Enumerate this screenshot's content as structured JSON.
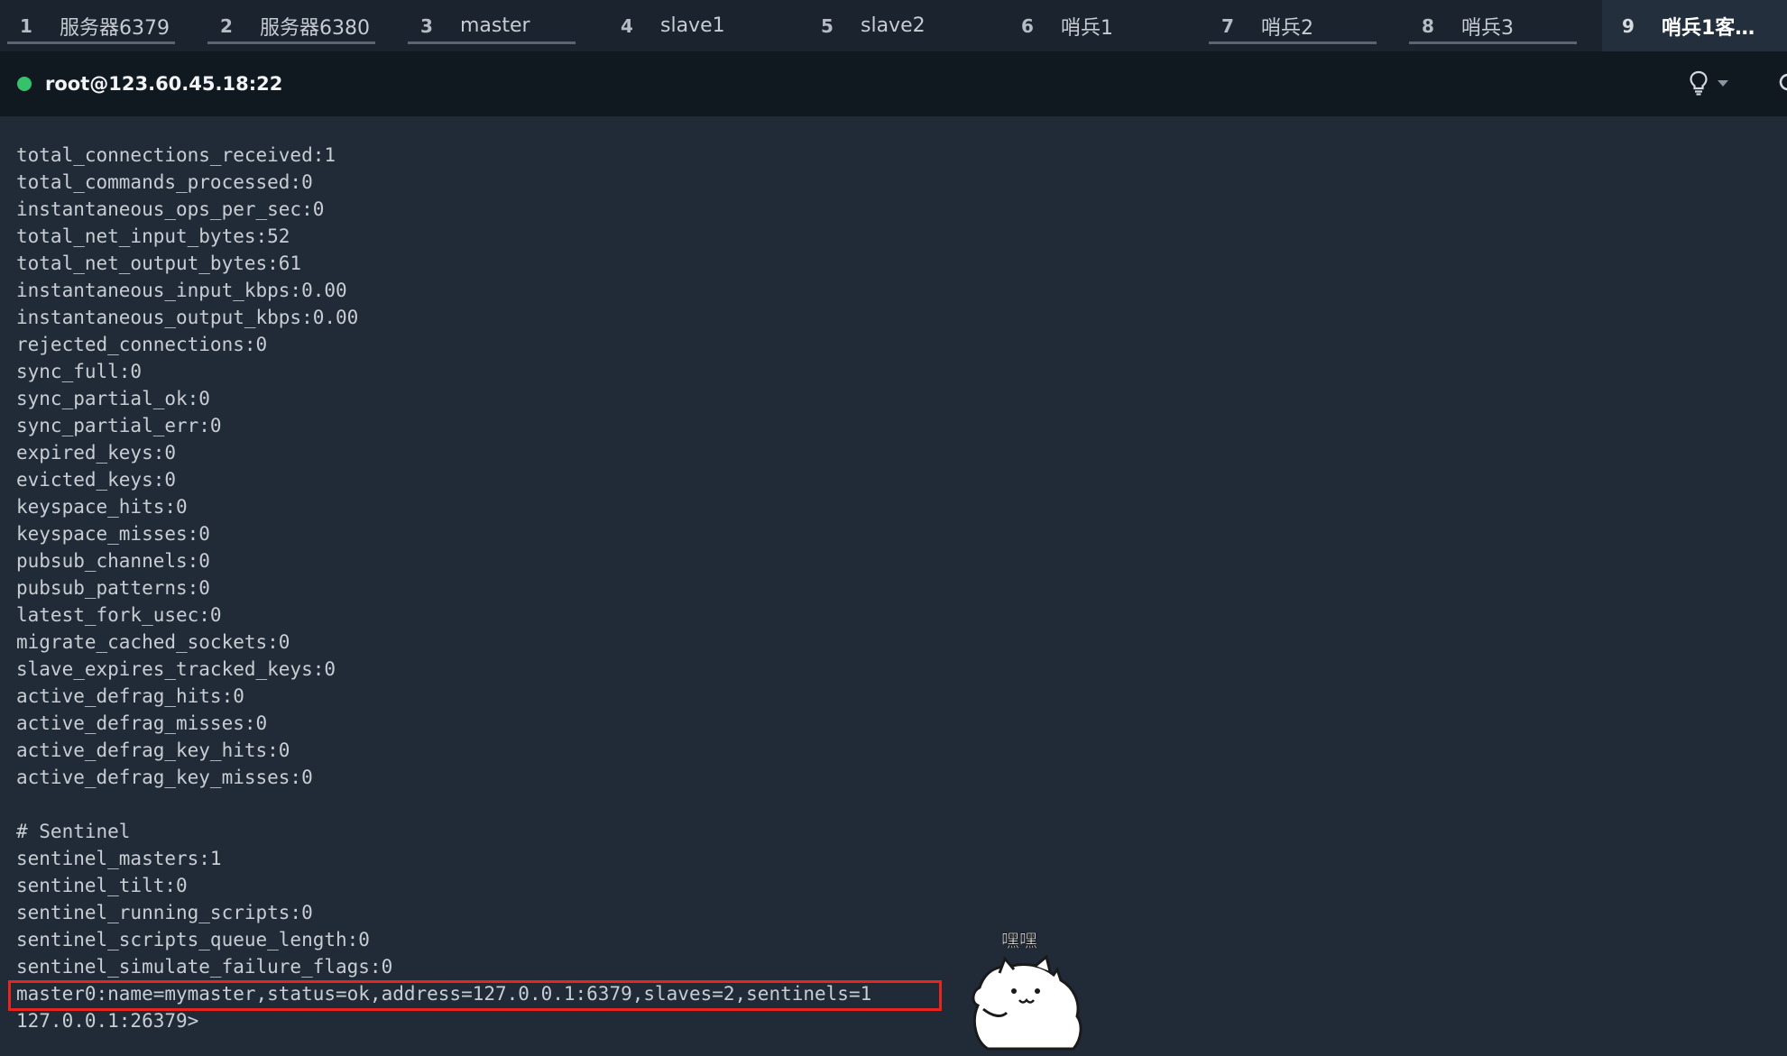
{
  "tabs": [
    {
      "num": "1",
      "label": "服务器6379"
    },
    {
      "num": "2",
      "label": "服务器6380"
    },
    {
      "num": "3",
      "label": "master"
    },
    {
      "num": "4",
      "label": "slave1"
    },
    {
      "num": "5",
      "label": "slave2"
    },
    {
      "num": "6",
      "label": "哨兵1"
    },
    {
      "num": "7",
      "label": "哨兵2"
    },
    {
      "num": "8",
      "label": "哨兵3"
    },
    {
      "num": "9",
      "label": "哨兵1客…",
      "active": true
    }
  ],
  "session": {
    "host": "root@123.60.45.18:22",
    "status": "connected",
    "status_color": "#35c26a",
    "hint_icon": "lightbulb-icon",
    "refresh_icon": "refresh-icon"
  },
  "terminal": {
    "lines": [
      "total_connections_received:1",
      "total_commands_processed:0",
      "instantaneous_ops_per_sec:0",
      "total_net_input_bytes:52",
      "total_net_output_bytes:61",
      "instantaneous_input_kbps:0.00",
      "instantaneous_output_kbps:0.00",
      "rejected_connections:0",
      "sync_full:0",
      "sync_partial_ok:0",
      "sync_partial_err:0",
      "expired_keys:0",
      "evicted_keys:0",
      "keyspace_hits:0",
      "keyspace_misses:0",
      "pubsub_channels:0",
      "pubsub_patterns:0",
      "latest_fork_usec:0",
      "migrate_cached_sockets:0",
      "slave_expires_tracked_keys:0",
      "active_defrag_hits:0",
      "active_defrag_misses:0",
      "active_defrag_key_hits:0",
      "active_defrag_key_misses:0",
      "",
      "# Sentinel",
      "sentinel_masters:1",
      "sentinel_tilt:0",
      "sentinel_running_scripts:0",
      "sentinel_scripts_queue_length:0",
      "sentinel_simulate_failure_flags:0",
      "master0:name=mymaster,status=ok,address=127.0.0.1:6379,slaves=2,sentinels=1",
      "127.0.0.1:26379>"
    ],
    "highlighted_line_index": 31,
    "highlight_color": "#e8241f"
  },
  "sticker": {
    "icon": "cat-sticker-icon",
    "caption": "嘿嘿"
  }
}
